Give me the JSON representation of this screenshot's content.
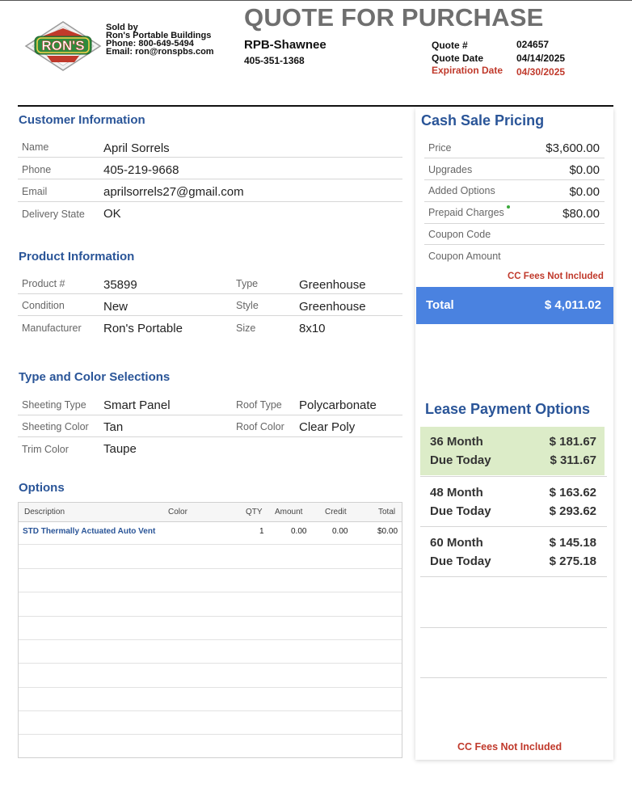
{
  "seller": {
    "sold_by": "Sold by",
    "company": "Ron's Portable Buildings",
    "phone": "Phone: 800-649-5494",
    "email": "Email: ron@ronspbs.com",
    "logo_text": "RON'S"
  },
  "header": {
    "title": "QUOTE FOR PURCHASE",
    "location": "RPB-Shawnee",
    "location_phone": "405-351-1368",
    "quote_number_label": "Quote #",
    "quote_number": "024657",
    "quote_date_label": "Quote Date",
    "quote_date": "04/14/2025",
    "expiration_label": "Expiration Date",
    "expiration_date": "04/30/2025"
  },
  "customer": {
    "title": "Customer Information",
    "rows": [
      {
        "label": "Name",
        "value": "April Sorrels"
      },
      {
        "label": "Phone",
        "value": "405-219-9668"
      },
      {
        "label": "Email",
        "value": "aprilsorrels27@gmail.com"
      },
      {
        "label": "Delivery State",
        "value": "OK"
      }
    ]
  },
  "product": {
    "title": "Product Information",
    "left": [
      {
        "label": "Product #",
        "value": "35899"
      },
      {
        "label": "Condition",
        "value": "New"
      },
      {
        "label": "Manufacturer",
        "value": "Ron's Portable"
      }
    ],
    "right": [
      {
        "label": "Type",
        "value": "Greenhouse"
      },
      {
        "label": "Style",
        "value": "Greenhouse"
      },
      {
        "label": "Size",
        "value": "8x10"
      }
    ]
  },
  "selections": {
    "title": "Type and Color Selections",
    "left": [
      {
        "label": "Sheeting Type",
        "value": "Smart Panel"
      },
      {
        "label": "Sheeting Color",
        "value": "Tan"
      },
      {
        "label": "Trim Color",
        "value": "Taupe"
      }
    ],
    "right": [
      {
        "label": "Roof Type",
        "value": "Polycarbonate"
      },
      {
        "label": "Roof Color",
        "value": "Clear Poly"
      }
    ]
  },
  "options": {
    "title": "Options",
    "headers": {
      "description": "Description",
      "color": "Color",
      "qty": "QTY",
      "amount": "Amount",
      "credit": "Credit",
      "total": "Total"
    },
    "rows": [
      {
        "description": "STD Thermally Actuated Auto Vent",
        "color": "",
        "qty": "1",
        "amount": "0.00",
        "credit": "0.00",
        "total": "$0.00"
      }
    ]
  },
  "cash_pricing": {
    "title": "Cash Sale Pricing",
    "rows": [
      {
        "label": "Price",
        "value": "$3,600.00"
      },
      {
        "label": "Upgrades",
        "value": "$0.00"
      },
      {
        "label": "Added Options",
        "value": "$0.00"
      },
      {
        "label": "Prepaid Charges",
        "value": "$80.00"
      },
      {
        "label": "Coupon Code",
        "value": ""
      },
      {
        "label": "Coupon Amount",
        "value": ""
      }
    ],
    "cc_note": "CC Fees Not Included",
    "total_label": "Total",
    "total_value": "$ 4,011.02"
  },
  "lease": {
    "title": "Lease Payment Options",
    "options": [
      {
        "term": "36 Month",
        "monthly": "$ 181.67",
        "due_label": "Due Today",
        "due": "$ 311.67"
      },
      {
        "term": "48 Month",
        "monthly": "$ 163.62",
        "due_label": "Due Today",
        "due": "$ 293.62"
      },
      {
        "term": "60 Month",
        "monthly": "$ 145.18",
        "due_label": "Due Today",
        "due": "$ 275.18"
      }
    ],
    "cc_note": "CC Fees Not Included"
  },
  "colors": {
    "accent_blue": "#2a5598",
    "total_bar": "#4a82e0",
    "alert_red": "#c0392b",
    "lease_highlight": "#dcecc8"
  }
}
